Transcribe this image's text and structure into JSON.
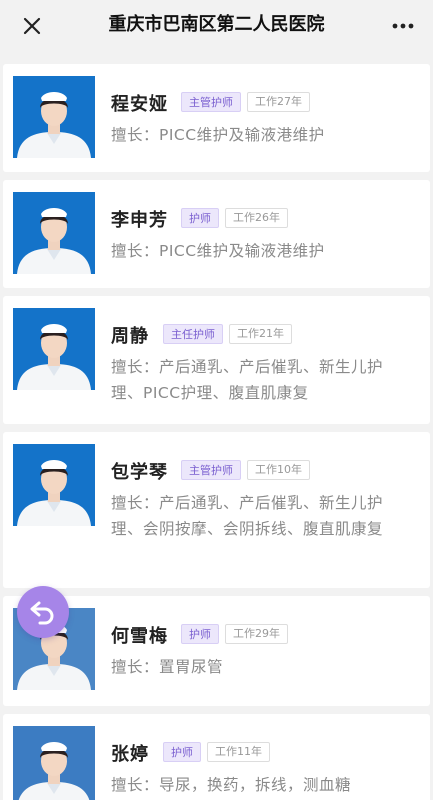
{
  "header": {
    "title": "重庆市巴南区第二人民医院",
    "close_icon": "close-icon",
    "more_icon": "more-horizontal-icon"
  },
  "accent_color": "#a685e8",
  "nurses": [
    {
      "name": "程安娅",
      "title": "主管护师",
      "years": "工作27年",
      "specialty": "擅长：PICC维护及输液港维护",
      "photo_bg": "#1473c9"
    },
    {
      "name": "李申芳",
      "title": "护师",
      "years": "工作26年",
      "specialty": "擅长：PICC维护及输液港维护",
      "photo_bg": "#1473c9"
    },
    {
      "name": "周静",
      "title": "主任护师",
      "years": "工作21年",
      "specialty": "擅长：产后通乳、产后催乳、新生儿护理、PICC护理、腹直肌康复",
      "photo_bg": "#1473c9"
    },
    {
      "name": "包学琴",
      "title": "主管护师",
      "years": "工作10年",
      "specialty": "擅长：产后通乳、产后催乳、新生儿护理、会阴按摩、会阴拆线、腹直肌康复",
      "photo_bg": "#1473c9"
    },
    {
      "name": "何雪梅",
      "title": "护师",
      "years": "工作29年",
      "specialty": "擅长：置胃尿管",
      "photo_bg": "#4a86c5"
    },
    {
      "name": "张婷",
      "title": "护师",
      "years": "工作11年",
      "specialty": "擅长：导尿，换药，拆线，测血糖",
      "photo_bg": "#3c7cc2"
    }
  ],
  "back_fab_icon": "undo-arrow-icon"
}
